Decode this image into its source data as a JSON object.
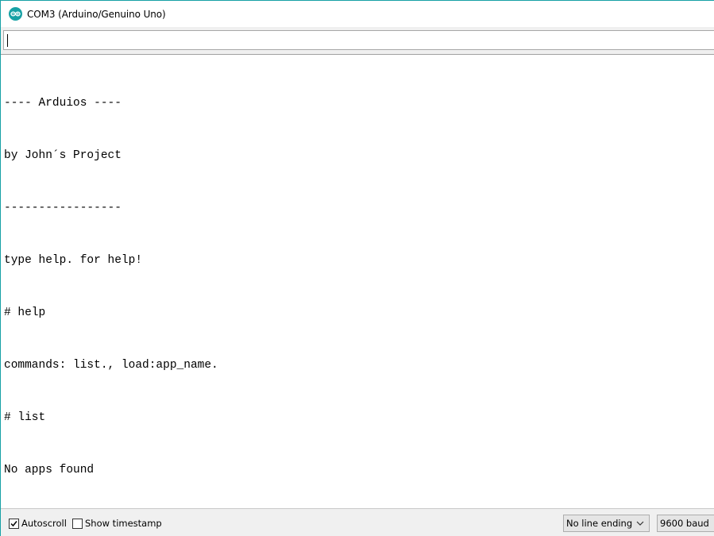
{
  "window": {
    "title": "COM3 (Arduino/Genuino Uno)",
    "icon": "arduino-icon",
    "accent_color": "#17a1a5"
  },
  "send": {
    "value": ""
  },
  "output": {
    "lines": [
      "---- Arduios ----",
      "by John´s Project",
      "-----------------",
      "type help. for help!",
      "# help",
      "commands: list., load:app_name.",
      "# list",
      "No apps found"
    ]
  },
  "statusbar": {
    "autoscroll": {
      "label": "Autoscroll",
      "checked": true
    },
    "timestamp": {
      "label": "Show timestamp",
      "checked": false
    },
    "line_ending": {
      "selected": "No line ending",
      "icon": "chevron-down-icon"
    },
    "baud_rate": {
      "selected": "9600 baud"
    }
  }
}
